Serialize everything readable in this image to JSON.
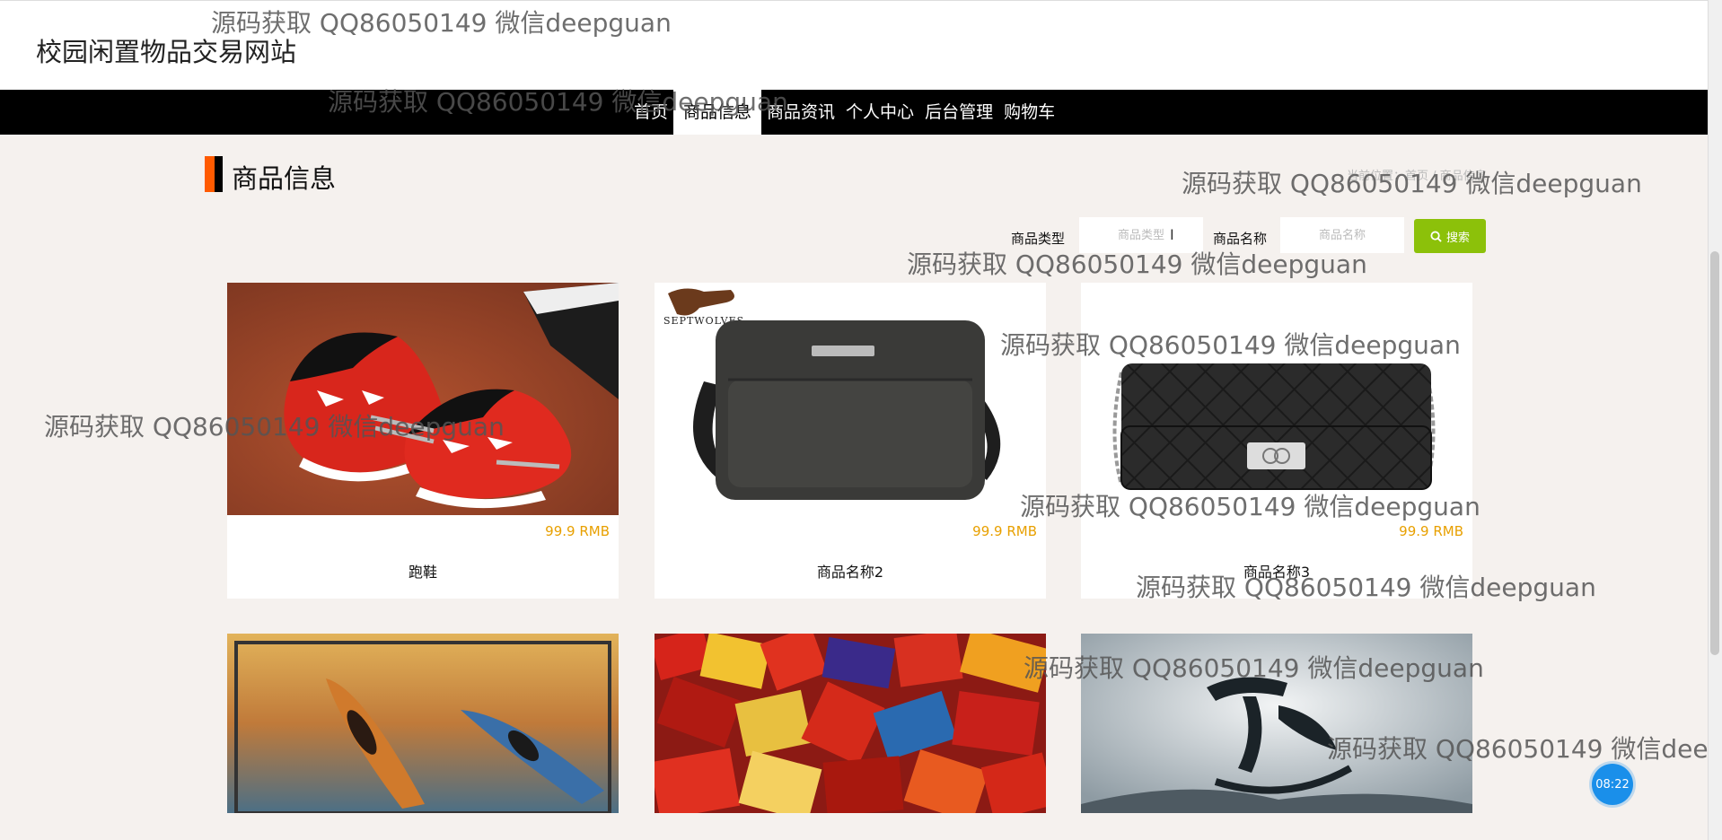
{
  "site": {
    "title": "校园闲置物品交易网站"
  },
  "nav": {
    "items": [
      {
        "label": "首页"
      },
      {
        "label": "商品信息",
        "active": true
      },
      {
        "label": "商品资讯"
      },
      {
        "label": "个人中心"
      },
      {
        "label": "后台管理"
      },
      {
        "label": "购物车"
      }
    ]
  },
  "section": {
    "title": "商品信息",
    "breadcrumb": "当前位置：首页 / 商品信息"
  },
  "search": {
    "type_label": "商品类型",
    "type_placeholder": "商品类型",
    "name_label": "商品名称",
    "name_placeholder": "商品名称",
    "button_label": "搜索"
  },
  "products": [
    {
      "name": "跑鞋",
      "price": "99.9 RMB",
      "image": "red-spiderman-shoes"
    },
    {
      "name": "商品名称2",
      "price": "99.9 RMB",
      "image": "gray-messenger-bag",
      "brand": "SEPTWOLVES"
    },
    {
      "name": "商品名称3",
      "price": "99.9 RMB",
      "image": "black-quilted-chain-bag"
    },
    {
      "name": "",
      "price": "",
      "image": "kayaks-on-water"
    },
    {
      "name": "",
      "price": "",
      "image": "snack-pile"
    },
    {
      "name": "",
      "price": "",
      "image": "ink-calligraphy"
    }
  ],
  "watermark": "源码获取 QQ86050149 微信deepguan",
  "clock": "08:22",
  "colors": {
    "nav_bg": "#000000",
    "accent_orange": "#ff5a00",
    "search_green": "#8cc10a",
    "price": "#e8a000"
  }
}
